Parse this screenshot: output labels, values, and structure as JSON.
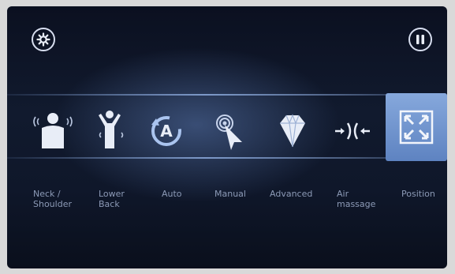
{
  "header": {
    "settings_icon": "gear-icon",
    "pause_icon": "pause-icon"
  },
  "modes": [
    {
      "label": "Neck / Shoulder",
      "icon": "neck-shoulder-icon",
      "selected": false
    },
    {
      "label": "Lower Back",
      "icon": "lower-back-icon",
      "selected": false
    },
    {
      "label": "Auto",
      "icon": "auto-icon",
      "selected": false
    },
    {
      "label": "Manual",
      "icon": "manual-touch-icon",
      "selected": false
    },
    {
      "label": "Advanced",
      "icon": "diamond-icon",
      "selected": false
    },
    {
      "label": "Air massage",
      "icon": "air-massage-icon",
      "selected": false
    },
    {
      "label": "Position",
      "icon": "position-icon",
      "selected": true
    }
  ],
  "colors": {
    "accent": "#6f93cf",
    "label": "#8c9ab6",
    "icon": "#e8edf7"
  }
}
